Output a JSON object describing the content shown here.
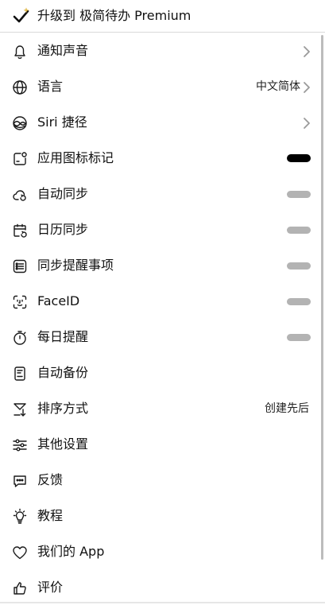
{
  "premium": {
    "label": "升级到 极简待办 Premium",
    "icon": "checkmark-sparkle-icon"
  },
  "settings": [
    {
      "label": "通知声音",
      "icon": "bell-icon",
      "chevron": true
    },
    {
      "label": "语言",
      "icon": "globe-icon",
      "value": "中文简体",
      "chevron": true
    },
    {
      "label": "Siri 捷径",
      "icon": "siri-icon",
      "chevron": true
    },
    {
      "label": "应用图标标记",
      "icon": "app-badge-icon",
      "toggle": "on"
    },
    {
      "label": "自动同步",
      "icon": "cloud-sync-icon",
      "toggle": "off"
    },
    {
      "label": "日历同步",
      "icon": "calendar-sync-icon",
      "toggle": "off"
    },
    {
      "label": "同步提醒事项",
      "icon": "reminders-list-icon",
      "toggle": "off"
    },
    {
      "label": "FaceID",
      "icon": "faceid-icon",
      "toggle": "off"
    },
    {
      "label": "每日提醒",
      "icon": "timer-icon",
      "toggle": "off"
    },
    {
      "label": "自动备份",
      "icon": "backup-document-icon"
    },
    {
      "label": "排序方式",
      "icon": "sort-icon",
      "value": "创建先后"
    },
    {
      "label": "其他设置",
      "icon": "sliders-icon"
    },
    {
      "label": "反馈",
      "icon": "chat-bubble-icon"
    },
    {
      "label": "教程",
      "icon": "lightbulb-icon"
    },
    {
      "label": "我们的 App",
      "icon": "heart-icon"
    },
    {
      "label": "评价",
      "icon": "thumbs-up-icon"
    }
  ]
}
